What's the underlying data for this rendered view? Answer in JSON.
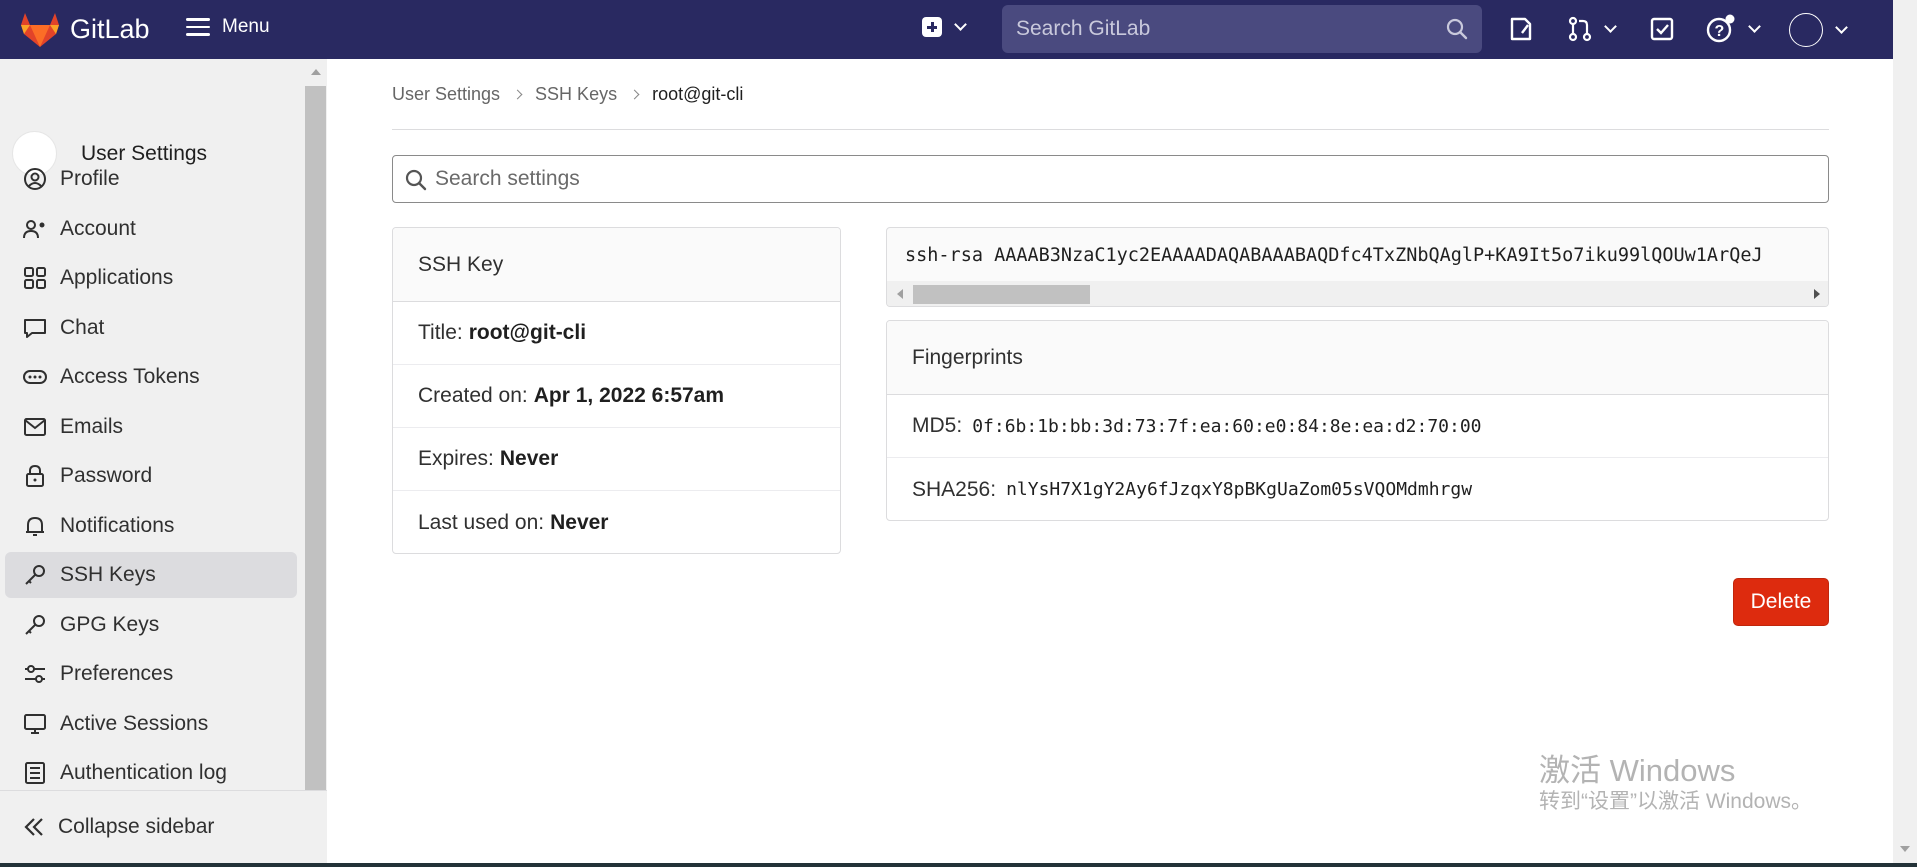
{
  "app": {
    "brand": "GitLab",
    "menu_label": "Menu"
  },
  "topnav": {
    "search_placeholder": "Search GitLab",
    "icons": [
      "plus-square-icon",
      "search-icon",
      "issues-icon",
      "merge-request-icon",
      "todo-icon",
      "help-icon",
      "user-avatar"
    ]
  },
  "sidebar": {
    "context_title": "User Settings",
    "items": [
      {
        "label": "Profile",
        "icon": "profile-icon",
        "active": false
      },
      {
        "label": "Account",
        "icon": "account-icon",
        "active": false
      },
      {
        "label": "Applications",
        "icon": "applications-icon",
        "active": false
      },
      {
        "label": "Chat",
        "icon": "chat-icon",
        "active": false
      },
      {
        "label": "Access Tokens",
        "icon": "token-icon",
        "active": false
      },
      {
        "label": "Emails",
        "icon": "mail-icon",
        "active": false
      },
      {
        "label": "Password",
        "icon": "lock-icon",
        "active": false
      },
      {
        "label": "Notifications",
        "icon": "bell-icon",
        "active": false
      },
      {
        "label": "SSH Keys",
        "icon": "key-icon",
        "active": true
      },
      {
        "label": "GPG Keys",
        "icon": "key-icon",
        "active": false
      },
      {
        "label": "Preferences",
        "icon": "preferences-icon",
        "active": false
      },
      {
        "label": "Active Sessions",
        "icon": "monitor-icon",
        "active": false
      },
      {
        "label": "Authentication log",
        "icon": "log-icon",
        "active": false
      }
    ],
    "collapse_label": "Collapse sidebar"
  },
  "breadcrumb": [
    "User Settings",
    "SSH Keys",
    "root@git-cli"
  ],
  "settings_search_placeholder": "Search settings",
  "ssh_key_card": {
    "heading": "SSH Key",
    "title_label": "Title:",
    "title_value": "root@git-cli",
    "created_label": "Created on:",
    "created_value": "Apr 1, 2022 6:57am",
    "expires_label": "Expires:",
    "expires_value": "Never",
    "last_used_label": "Last used on:",
    "last_used_value": "Never"
  },
  "key_text": "ssh-rsa AAAAB3NzaC1yc2EAAAADAQABAAABAQDfc4TxZNbQAglP+KA9It5o7iku99lQOUw1ArQeJ",
  "fingerprints": {
    "heading": "Fingerprints",
    "md5_label": "MD5:",
    "md5_value": "0f:6b:1b:bb:3d:73:7f:ea:60:e0:84:8e:ea:d2:70:00",
    "sha256_label": "SHA256:",
    "sha256_value": "nlYsH7X1gY2Ay6fJzqxY8pBKgUaZom05sVQOMdmhrgw"
  },
  "delete_label": "Delete",
  "watermark": {
    "line1": "激活 Windows",
    "line2": "转到“设置”以激活 Windows。"
  },
  "colors": {
    "topbar": "#292961",
    "delete": "#dd2b0e",
    "sidebar_bg": "#f0f0f0"
  }
}
